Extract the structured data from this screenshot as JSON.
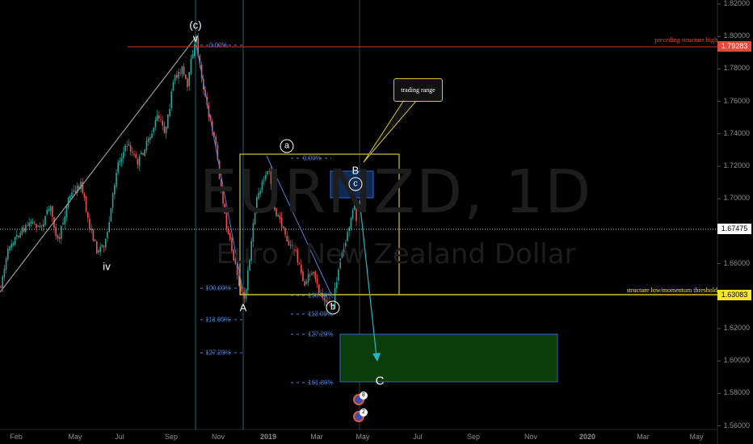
{
  "watermark": {
    "symbol": "EURNZD, 1D",
    "name": "Euro / New Zealand Dollar"
  },
  "chart_data": {
    "type": "candlestick",
    "y_ticks": [
      "1.82000",
      "1.80000",
      "1.78000",
      "1.76000",
      "1.74000",
      "1.72000",
      "1.70000",
      "1.68000",
      "1.66000",
      "1.64000",
      "1.62000",
      "1.60000",
      "1.58000",
      "1.56000"
    ],
    "x_ticks": [
      "Feb",
      "May",
      "Jul",
      "Sep",
      "Nov",
      "2019",
      "Mar",
      "May",
      "Jul",
      "Sep",
      "Nov",
      "2020",
      "Mar",
      "May"
    ],
    "ylim": [
      1.55,
      1.825
    ],
    "path": [
      [
        0,
        1.645
      ],
      [
        12,
        1.672
      ],
      [
        25,
        1.679
      ],
      [
        38,
        1.686
      ],
      [
        50,
        1.682
      ],
      [
        62,
        1.695
      ],
      [
        72,
        1.673
      ],
      [
        85,
        1.701
      ],
      [
        100,
        1.709
      ],
      [
        110,
        1.685
      ],
      [
        120,
        1.668
      ],
      [
        132,
        1.674
      ],
      [
        145,
        1.721
      ],
      [
        158,
        1.734
      ],
      [
        170,
        1.722
      ],
      [
        185,
        1.737
      ],
      [
        195,
        1.751
      ],
      [
        205,
        1.741
      ],
      [
        215,
        1.773
      ],
      [
        225,
        1.781
      ],
      [
        232,
        1.768
      ],
      [
        238,
        1.79
      ],
      [
        243,
        1.797
      ],
      [
        250,
        1.774
      ],
      [
        258,
        1.751
      ],
      [
        266,
        1.738
      ],
      [
        272,
        1.712
      ],
      [
        280,
        1.683
      ],
      [
        290,
        1.662
      ],
      [
        297,
        1.645
      ],
      [
        303,
        1.637
      ],
      [
        310,
        1.669
      ],
      [
        318,
        1.702
      ],
      [
        326,
        1.711
      ],
      [
        333,
        1.718
      ],
      [
        340,
        1.693
      ],
      [
        348,
        1.685
      ],
      [
        357,
        1.672
      ],
      [
        366,
        1.668
      ],
      [
        376,
        1.647
      ],
      [
        386,
        1.655
      ],
      [
        396,
        1.642
      ],
      [
        404,
        1.638
      ],
      [
        412,
        1.634
      ],
      [
        420,
        1.661
      ],
      [
        428,
        1.673
      ],
      [
        435,
        1.69
      ],
      [
        440,
        1.696
      ],
      [
        442,
        1.678
      ]
    ],
    "price_labels": [
      "1.79283",
      "1.67475",
      "1.63083"
    ],
    "annotations": {
      "preceding_high": "preceding structure high",
      "structure_low": "structure low/momentum threshold",
      "callout": "trading range"
    },
    "waves": [
      "(c)",
      "v",
      "iv",
      "a",
      "A",
      "b",
      "c",
      "B",
      "C"
    ],
    "fib_left": [
      "0.00%",
      "100.00%",
      "113.00%",
      "127.20%"
    ],
    "fib_right": [
      "0.00%",
      "138.00%",
      "113.00%",
      "127.20%",
      "161.80%"
    ],
    "events": [
      "8",
      "2"
    ],
    "colors": {
      "up": "#26a69a",
      "down": "#ef5350",
      "box": "#d7c43a",
      "target": "#0a3d0a",
      "cyan": "#26b5c8",
      "fib": "#4f7fd8"
    }
  }
}
